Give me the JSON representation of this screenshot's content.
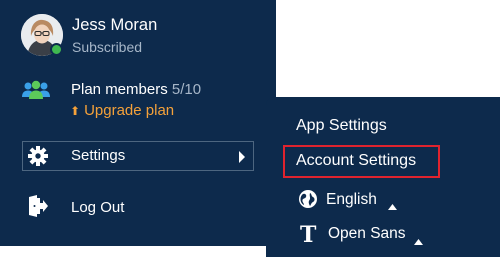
{
  "user": {
    "name": "Jess Moran",
    "subscription": "Subscribed"
  },
  "plan": {
    "label": "Plan members",
    "count": "5/10",
    "upgrade_label": "Upgrade plan"
  },
  "menu": {
    "settings_label": "Settings",
    "logout_label": "Log Out"
  },
  "submenu": {
    "app_settings": "App Settings",
    "account_settings": "Account Settings",
    "language": "English",
    "font": "Open Sans"
  },
  "icons": {
    "members": "members-icon",
    "settings": "gear-icon",
    "logout": "logout-icon",
    "language": "globe-icon",
    "font": "font-icon"
  },
  "colors": {
    "sidebar_bg": "#0d2a4c",
    "accent_orange": "#f4a13a",
    "status_green": "#3fb950",
    "highlight_red": "#e0232e"
  }
}
